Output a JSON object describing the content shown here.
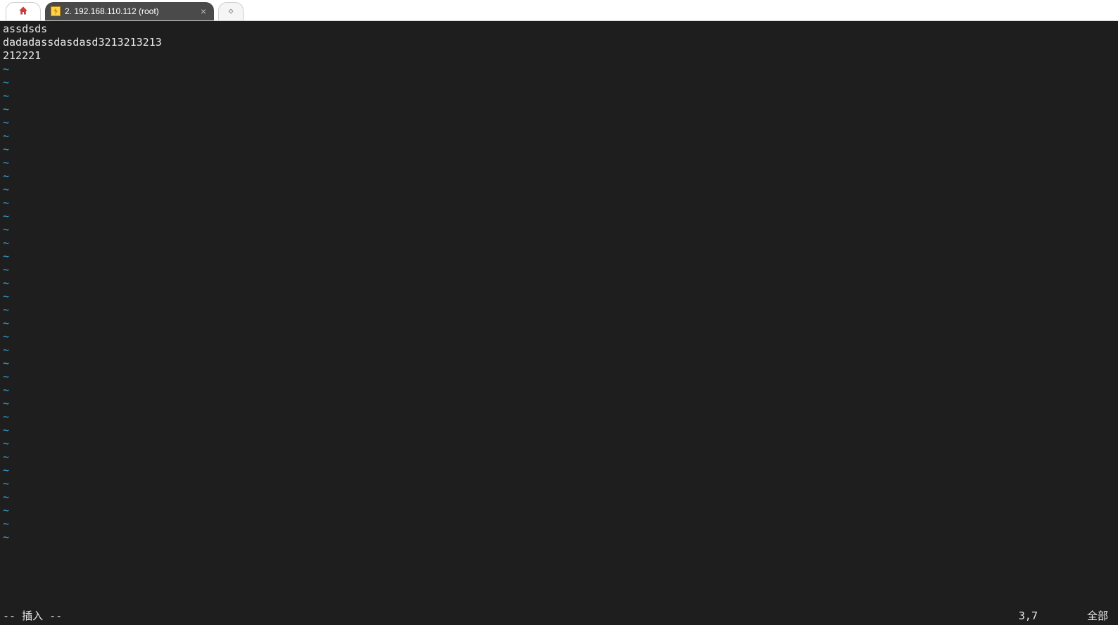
{
  "tabs": {
    "session_label": "2. 192.168.110.112 (root)",
    "session_icon_name": "lightning-icon",
    "close_glyph": "×",
    "new_tab_icon_name": "diamond-icon"
  },
  "editor": {
    "content_lines": [
      "assdsds",
      "dadadassdasdasd3213213213",
      "212221"
    ],
    "tilde_char": "~",
    "tilde_count": 36
  },
  "status": {
    "mode": "-- 插入 --",
    "position": "3,7",
    "view": "全部"
  },
  "colors": {
    "terminal_bg": "#1e1e1e",
    "text": "#e8e8e8",
    "tilde": "#3ba3d8",
    "tab_active_bg": "#4a4a4a"
  }
}
